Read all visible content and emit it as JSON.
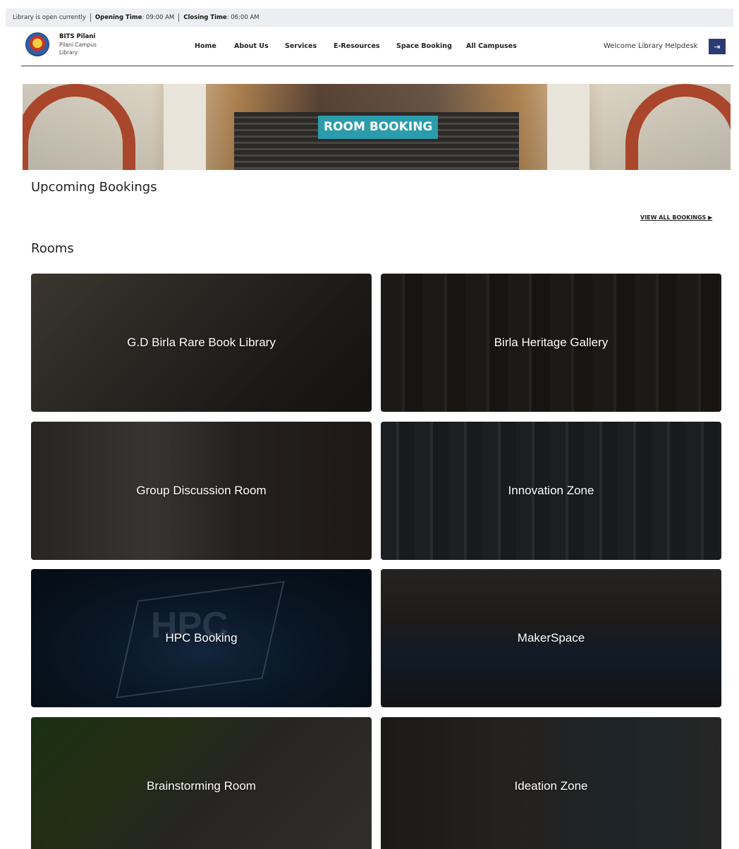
{
  "topbar": {
    "status": "Library is open currently",
    "opening_label": "Opening Time",
    "opening_value": ": 09:00 AM",
    "closing_label": "Closing Time",
    "closing_value": ": 06:00 AM"
  },
  "brand": {
    "line1": "BITS Pilani",
    "line2": "Pilani Campus",
    "line3": "Library"
  },
  "nav": {
    "items": [
      "Home",
      "About Us",
      "Services",
      "E-Resources",
      "Space Booking",
      "All Campuses"
    ],
    "welcome": "Welcome Library Helpdesk",
    "logout_icon": "logout-icon"
  },
  "hero": {
    "title": "ROOM BOOKING"
  },
  "upcoming": {
    "title": "Upcoming Bookings",
    "view_all": "VIEW ALL BOOKINGS ▶"
  },
  "rooms": {
    "title": "Rooms",
    "items": [
      "G.D Birla Rare Book Library",
      "Birla Heritage Gallery",
      "Group Discussion Room",
      "Innovation Zone",
      "HPC Booking",
      "MakerSpace",
      "Brainstorming Room",
      "Ideation Zone"
    ],
    "hpc_watermark": "HPC"
  },
  "colors": {
    "accent": "#2b9cab",
    "logout_bg": "#2c3a73",
    "topbar_bg": "#eceef1"
  }
}
